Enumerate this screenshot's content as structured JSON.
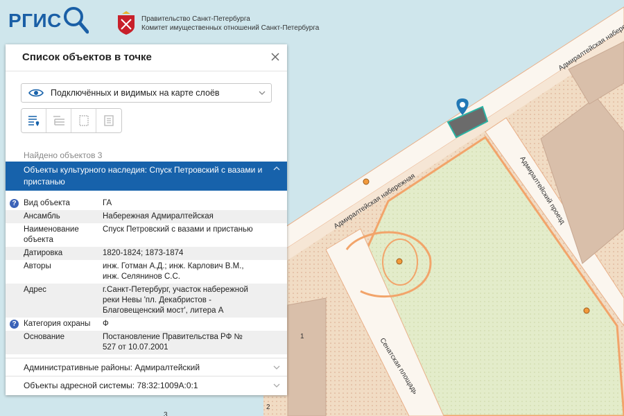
{
  "header": {
    "logo_text": "РГИС",
    "gov_line1": "Правительство Санкт-Петербурга",
    "gov_line2": "Комитет имущественных отношений Санкт-Петербурга"
  },
  "map": {
    "labels": {
      "embankment_upper": "Адмиралтейская набережная",
      "embankment_lower": "Адмиралтейская набережная",
      "proezd": "Адмиралтейский проезд",
      "square": "Сенатская площадь",
      "num1": "1",
      "num2": "2",
      "num3": "3"
    },
    "colors": {
      "water": "#cfe6ec",
      "land": "#f1e0cc",
      "road": "#fbf6ef",
      "park": "#e2ecc9",
      "outline": "#f2a46a",
      "marker": "#2278b5"
    }
  },
  "panel": {
    "title": "Список объектов в точке",
    "layer_select": "Подключённых и видимых на карте слоёв",
    "found": "Найдено объектов 3",
    "selected_group": "Объекты культурного наследия: Спуск Петровский с вазами и пристанью",
    "properties": [
      {
        "key": "Вид объекта",
        "value": "ГА",
        "help": true
      },
      {
        "key": "Ансамбль",
        "value": "Набережная Адмиралтейская",
        "help": false
      },
      {
        "key": "Наименование объекта",
        "value": "Спуск Петровский с вазами и пристанью",
        "help": false
      },
      {
        "key": "Датировка",
        "value": "1820-1824; 1873-1874",
        "help": false
      },
      {
        "key": "Авторы",
        "value": "инж. Готман А.Д.; инж. Карлович В.М., инж. Селянинов С.С.",
        "help": false
      },
      {
        "key": "Адрес",
        "value": "г.Санкт-Петербург, участок набережной реки Невы 'пл. Декабристов - Благовещенский мост', литера А",
        "help": false
      },
      {
        "key": "Категория охраны",
        "value": "Ф",
        "help": true
      },
      {
        "key": "Основание",
        "value": "Постановление Правительства РФ № 527 от 10.07.2001",
        "help": false
      }
    ],
    "other_groups": [
      "Административные районы: Адмиралтейский",
      "Объекты адресной системы: 78:32:1009А:0:1"
    ],
    "help_glyph": "?"
  }
}
